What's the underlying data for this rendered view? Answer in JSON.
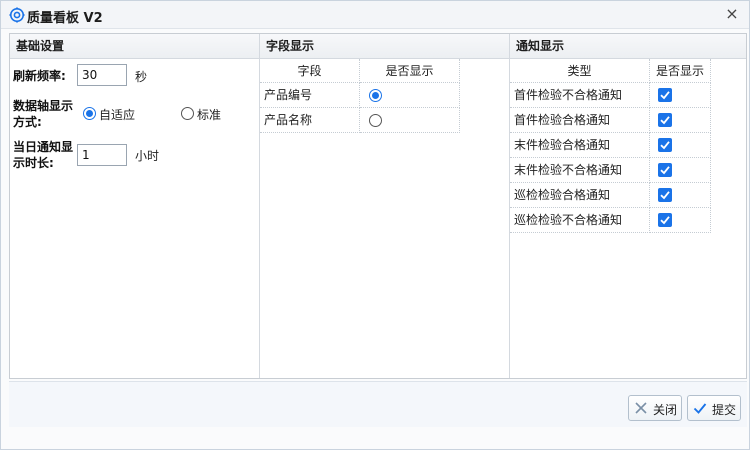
{
  "window": {
    "title": "质量看板 V2",
    "close_glyph": "×",
    "title_icon": "gear-icon"
  },
  "basic": {
    "header": "基础设置",
    "refresh_label": "刷新频率:",
    "refresh_value": "30",
    "refresh_unit": "秒",
    "axis_label_line1": "数据轴显示",
    "axis_label_line2": "方式:",
    "axis_options": [
      {
        "label": "自适应",
        "selected": true
      },
      {
        "label": "标准",
        "selected": false
      }
    ],
    "notify_label_line1": "当日通知显",
    "notify_label_line2": "示时长:",
    "notify_value": "1",
    "notify_unit": "小时"
  },
  "fields": {
    "header": "字段显示",
    "columns": [
      "字段",
      "是否显示"
    ],
    "rows": [
      {
        "name": "产品编号",
        "selected": true
      },
      {
        "name": "产品名称",
        "selected": false
      }
    ]
  },
  "notify": {
    "header": "通知显示",
    "columns": [
      "类型",
      "是否显示"
    ],
    "rows": [
      {
        "name": "首件检验不合格通知",
        "checked": true
      },
      {
        "name": "首件检验合格通知",
        "checked": true
      },
      {
        "name": "末件检验合格通知",
        "checked": true
      },
      {
        "name": "末件检验不合格通知",
        "checked": true
      },
      {
        "name": "巡检检验合格通知",
        "checked": true
      },
      {
        "name": "巡检检验不合格通知",
        "checked": true
      }
    ]
  },
  "footer": {
    "close_label": "关闭",
    "submit_label": "提交"
  },
  "colors": {
    "accent": "#1a73e8",
    "title_icon": "#1a73e8",
    "close_icon": "#7a8fa6",
    "submit_icon": "#1a73e8"
  }
}
